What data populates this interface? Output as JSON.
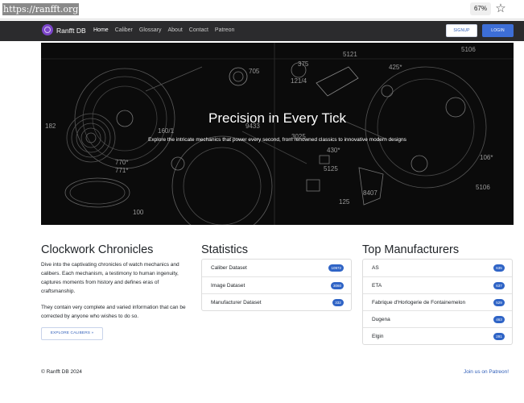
{
  "browser": {
    "url": "https://ranfft.org",
    "zoom": "67%",
    "bookmark_icon": "star-outline-icon"
  },
  "nav": {
    "brand": "Ranfft DB",
    "brand_icon": "gear-logo-icon",
    "links": [
      "Home",
      "Caliber",
      "Glossary",
      "About",
      "Contact",
      "Patreon"
    ],
    "active": "Home",
    "signup": "SIGNUP",
    "login": "LOGIN"
  },
  "hero": {
    "title": "Precision in Every Tick",
    "subtitle": "Explore the intricate mechanics that power every second, from renowned classics to innovative modern designs",
    "part_numbers": [
      "5121",
      "5106",
      "375",
      "121/4",
      "705",
      "425*",
      "182",
      "160/1",
      "9433",
      "770*",
      "771*",
      "3025",
      "5125",
      "430*",
      "106*",
      "8407",
      "5106",
      "125",
      "100"
    ]
  },
  "chronicles": {
    "title": "Clockwork Chronicles",
    "paragraph1": "Dive into the captivating chronicles of watch mechanics and calibers. Each mechanism, a testimony to human ingenuity, captures moments from history and defines eras of craftsmanship.",
    "paragraph2": "They contain very complete and varied information that can be corrected by anyone who wishes to do so.",
    "button": "EXPLORE CALIBERS »"
  },
  "statistics": {
    "title": "Statistics",
    "items": [
      {
        "label": "Caliber Dataset",
        "count": "10972"
      },
      {
        "label": "Image Dataset",
        "count": "3060"
      },
      {
        "label": "Manufacturer Dataset",
        "count": "332"
      }
    ]
  },
  "manufacturers": {
    "title": "Top Manufacturers",
    "items": [
      {
        "label": "AS",
        "count": "635"
      },
      {
        "label": "ETA",
        "count": "637"
      },
      {
        "label": "Fabrique d'Horlogerie de Fontainemelon",
        "count": "529"
      },
      {
        "label": "Dugena",
        "count": "463"
      },
      {
        "label": "Elgin",
        "count": "291"
      }
    ]
  },
  "footer": {
    "copyright": "© Ranfft DB 2024",
    "patreon": "Join us on Patreon!"
  },
  "colors": {
    "navbar": "#2b2b2d",
    "brand_icon": "#7b45c9",
    "primary": "#3d6ed6",
    "badge": "#2f64c6",
    "hero_bg": "#0b0b0b"
  }
}
